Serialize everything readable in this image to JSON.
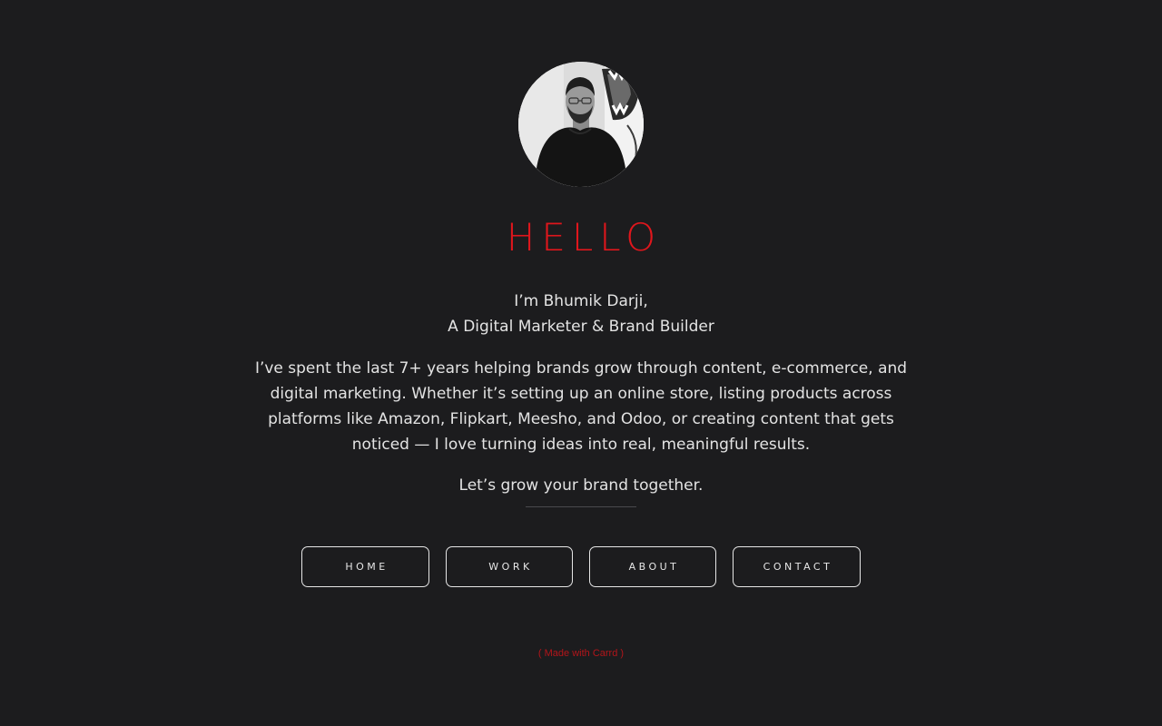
{
  "profile": {
    "avatar_icon": "profile-photo"
  },
  "heading": "HELLO",
  "intro": {
    "line1": "I’m Bhumik Darji,",
    "line2": "A Digital Marketer & Brand Builder"
  },
  "bio": "I’ve spent the last 7+ years helping brands grow through content, e-commerce, and digital marketing. Whether it’s setting up an online store, listing products across platforms like Amazon, Flipkart, Meesho, and Odoo, or creating content that gets noticed — I love turning ideas into real, meaningful results.",
  "cta": "Let’s grow your brand together.",
  "nav": {
    "home": "HOME",
    "work": "WORK",
    "about": "ABOUT",
    "contact": "CONTACT"
  },
  "footer": {
    "credit": "( Made with Carrd )"
  },
  "colors": {
    "background": "#1c1c1e",
    "accent": "#e0161c",
    "text": "#e3e3e3"
  }
}
